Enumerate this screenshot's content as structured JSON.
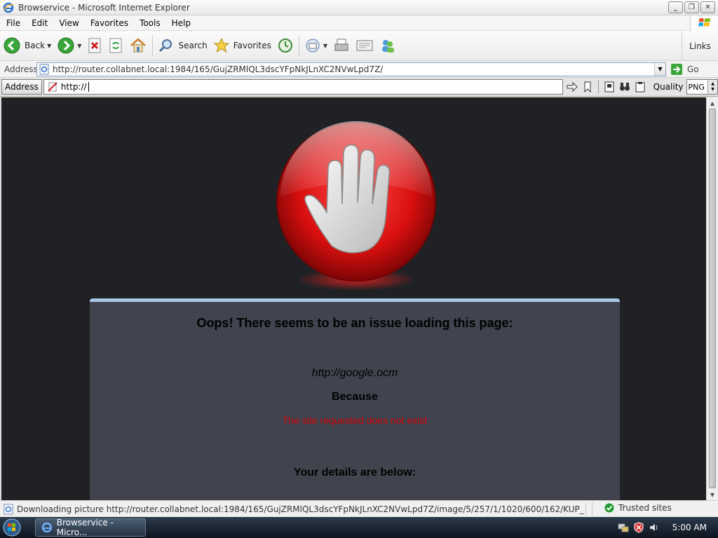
{
  "window": {
    "title": "Browservice - Microsoft Internet Explorer"
  },
  "menu": [
    "File",
    "Edit",
    "View",
    "Favorites",
    "Tools",
    "Help"
  ],
  "toolbar": {
    "back_label": "Back",
    "search_label": "Search",
    "favorites_label": "Favorites",
    "links_label": "Links"
  },
  "address": {
    "label": "Address",
    "url": "http://router.collabnet.local:1984/165/GujZRMlQL3dscYFpNkJLnXC2NVwLpd7Z/",
    "go_label": "Go"
  },
  "browservice": {
    "address_label": "Address",
    "url_value": "http://",
    "quality_label": "Quality",
    "quality_value": "PNG"
  },
  "page": {
    "heading": "Oops! There seems to be an issue loading this page:",
    "bad_url": "http://google.ocm",
    "because": "Because",
    "reason": "The site requested does not exist",
    "details": "Your details are below:"
  },
  "status": {
    "text": "Downloading picture http://router.collabnet.local:1984/165/GujZRMlQL3dscYFpNkJLnXC2NVwLpd7Z/image/5/257/1/1020/600/162/KUP_",
    "zone": "Trusted sites"
  },
  "taskbar": {
    "task_label": "Browservice - Micro...",
    "clock": "5:00 AM"
  }
}
